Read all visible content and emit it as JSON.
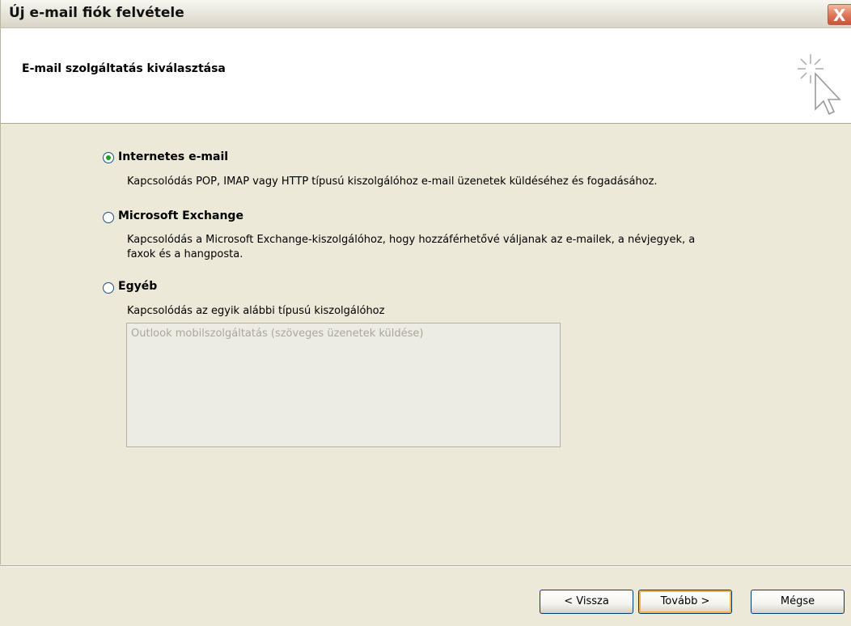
{
  "window": {
    "title": "Új e-mail fiók felvétele",
    "close_label": "X"
  },
  "header": {
    "title": "E-mail szolgáltatás kiválasztása",
    "icon": "wizard-cursor-icon"
  },
  "options": [
    {
      "label": "Internetes e-mail",
      "description": "Kapcsolódás POP, IMAP vagy HTTP típusú kiszolgálóhoz e-mail üzenetek küldéséhez és fogadásához.",
      "checked": true
    },
    {
      "label": "Microsoft Exchange",
      "description_line1": "Kapcsolódás a Microsoft Exchange-kiszolgálóhoz, hogy hozzáférhetővé váljanak az e-mailek, a névjegyek, a",
      "description_line2": "faxok és a hangposta.",
      "checked": false
    },
    {
      "label": "Egyéb",
      "description": "Kapcsolódás az egyik alábbi típusú kiszolgálóhoz",
      "checked": false,
      "list_items": [
        "Outlook mobilszolgáltatás (szöveges üzenetek küldése)"
      ]
    }
  ],
  "footer": {
    "back_label": "< Vissza",
    "next_label": "Tovább >",
    "cancel_label": "Mégse"
  },
  "colors": {
    "dialog_bg": "#ece9d8",
    "radio_dot": "#21a121",
    "default_button_highlight": "#f8b34a"
  }
}
